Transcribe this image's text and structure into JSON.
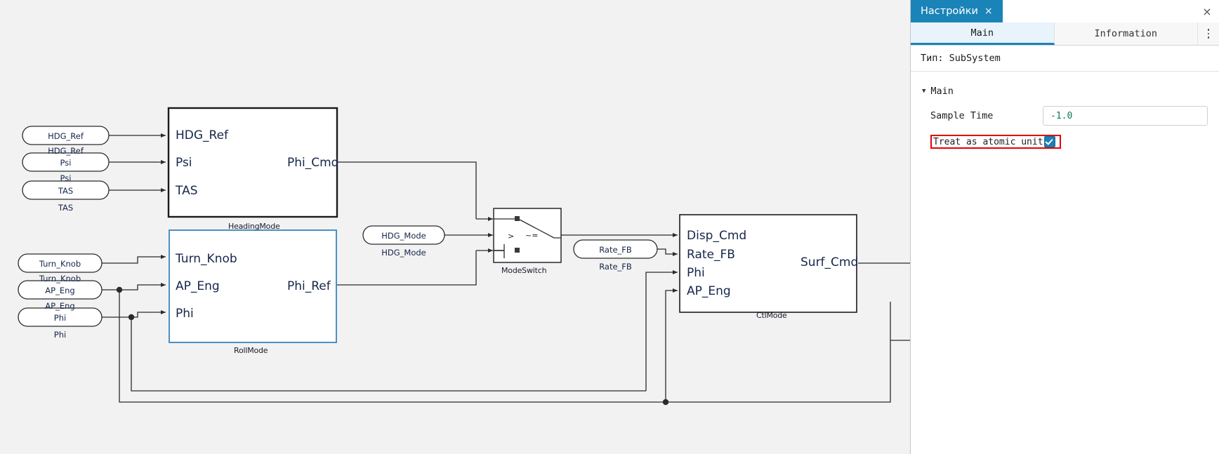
{
  "panel": {
    "chip_title": "Настройки",
    "chip_close": "×",
    "window_close": "×",
    "tabs": [
      {
        "label": "Main",
        "active": true
      },
      {
        "label": "Information",
        "active": false
      }
    ],
    "more_menu": "kebab-menu",
    "type_line": "Тип: SubSystem",
    "section": {
      "caret": "▼",
      "title": "Main"
    },
    "fields": [
      {
        "label": "Sample Time",
        "value": "-1.0"
      }
    ],
    "checkbox": {
      "label": "Treat as atomic unit",
      "checked": true
    },
    "highlight_color": "#e60000",
    "accent_color": "#1a84b8"
  },
  "canvas": {
    "subsystem_blocks": [
      {
        "name": "HeadingMode",
        "inputs": [
          "HDG_Ref",
          "Psi",
          "TAS"
        ],
        "outputs": [
          "Phi_Cmd"
        ]
      },
      {
        "name": "RollMode",
        "inputs": [
          "Turn_Knob",
          "AP_Eng",
          "Phi"
        ],
        "outputs": [
          "Phi_Ref"
        ]
      },
      {
        "name": "CtlMode",
        "inputs": [
          "Disp_Cmd",
          "Rate_FB",
          "Phi",
          "AP_Eng"
        ],
        "outputs": [
          "Surf_Cmd"
        ]
      }
    ],
    "switch_block": {
      "name": "ModeSwitch",
      "symbol_gt": ">",
      "symbol_ne": "~="
    },
    "inports": [
      {
        "text": "HDG_Ref",
        "caption": "HDG_Ref"
      },
      {
        "text": "Psi",
        "caption": "Psi"
      },
      {
        "text": "TAS",
        "caption": "TAS"
      },
      {
        "text": "Turn_Knob",
        "caption": "Turn_Knob"
      },
      {
        "text": "AP_Eng",
        "caption": "AP_Eng"
      },
      {
        "text": "Phi",
        "caption": "Phi"
      },
      {
        "text": "HDG_Mode",
        "caption": "HDG_Mode"
      },
      {
        "text": "Rate_FB",
        "caption": "Rate_FB"
      }
    ]
  }
}
